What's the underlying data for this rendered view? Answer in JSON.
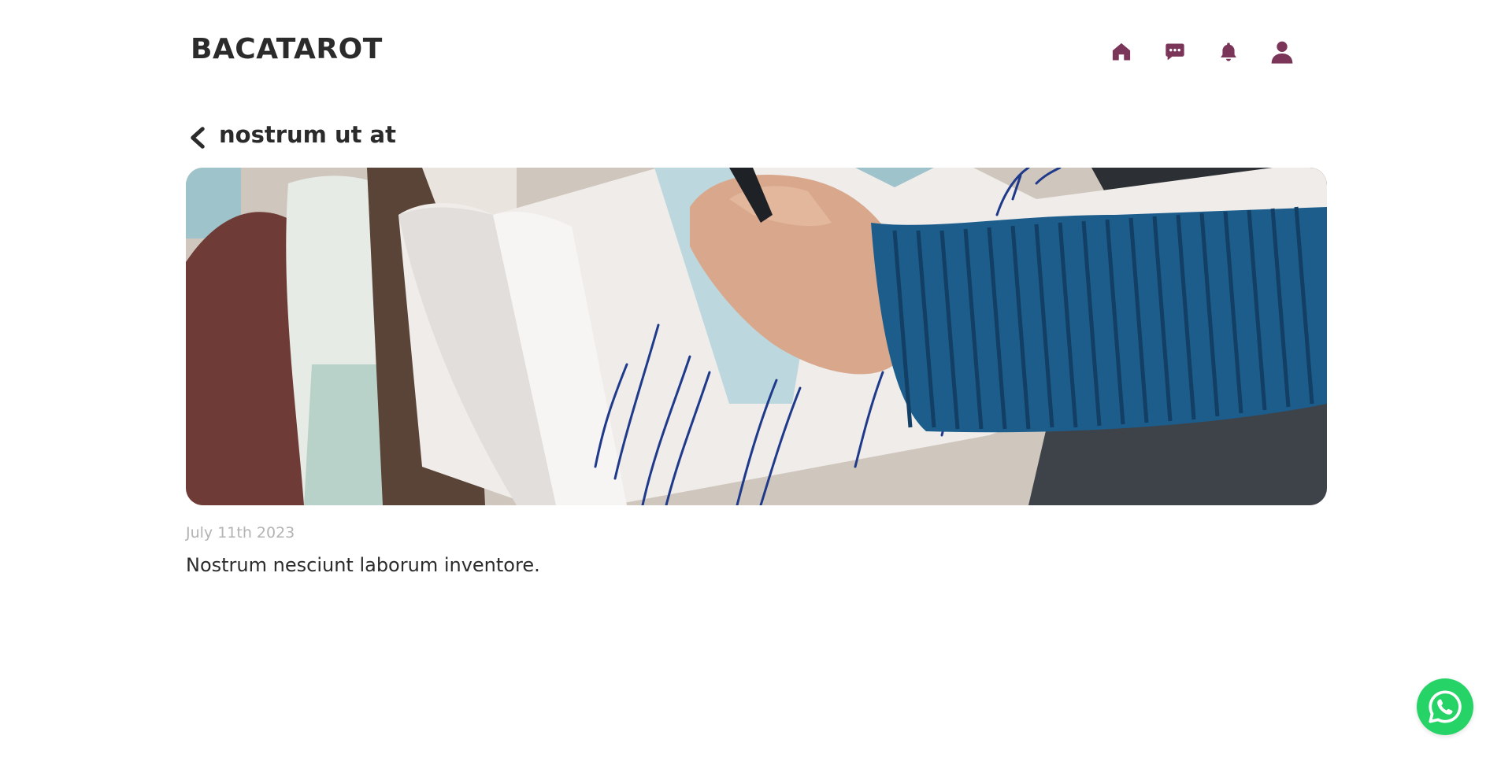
{
  "header": {
    "brand": "BACATAROT",
    "accent_color": "#7a3558",
    "nav_icons": [
      "home-icon",
      "chat-icon",
      "bell-icon",
      "user-icon"
    ]
  },
  "post": {
    "back_icon": "chevron-left-icon",
    "title": "nostrum ut at",
    "image": "photo of a hand writing in a notebook with a pen",
    "date": "July 11th 2023",
    "body": "Nostrum nesciunt laborum inventore."
  },
  "floating": {
    "whatsapp_icon": "whatsapp-icon",
    "whatsapp_color": "#25d366"
  }
}
